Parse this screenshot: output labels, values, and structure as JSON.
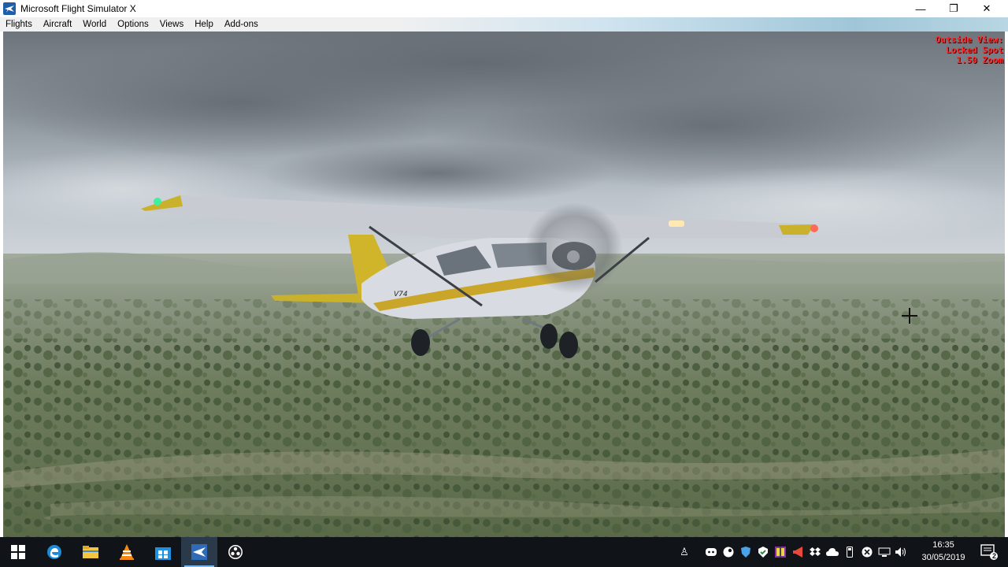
{
  "window": {
    "title": "Microsoft Flight Simulator X",
    "controls": {
      "minimize": "—",
      "restore": "❐",
      "close": "✕"
    }
  },
  "menu": {
    "items": [
      "Flights",
      "Aircraft",
      "World",
      "Options",
      "Views",
      "Help",
      "Add-ons"
    ]
  },
  "hud": {
    "line1": "Outside View:",
    "line2": "Locked Spot",
    "line3": "1.50 Zoom",
    "color": "#ff2a2a"
  },
  "aircraft": {
    "tail_text": "N"
  },
  "taskbar": {
    "apps": [
      "start-icon",
      "edge-icon",
      "file-explorer-icon",
      "vlc-icon",
      "store-icon",
      "fsx-icon",
      "obs-icon"
    ],
    "active_app": "fsx-icon",
    "tray_icons": [
      "people-icon",
      "discord-icon",
      "steam-icon",
      "shield-icon",
      "security-icon",
      "winrar-icon",
      "speaker-icon",
      "dropbox-icon",
      "onedrive-icon",
      "usb-icon",
      "antivirus-icon",
      "network-icon",
      "volume-icon"
    ],
    "clock": {
      "time": "16:35",
      "date": "30/05/2019"
    },
    "notification_count": "2"
  }
}
